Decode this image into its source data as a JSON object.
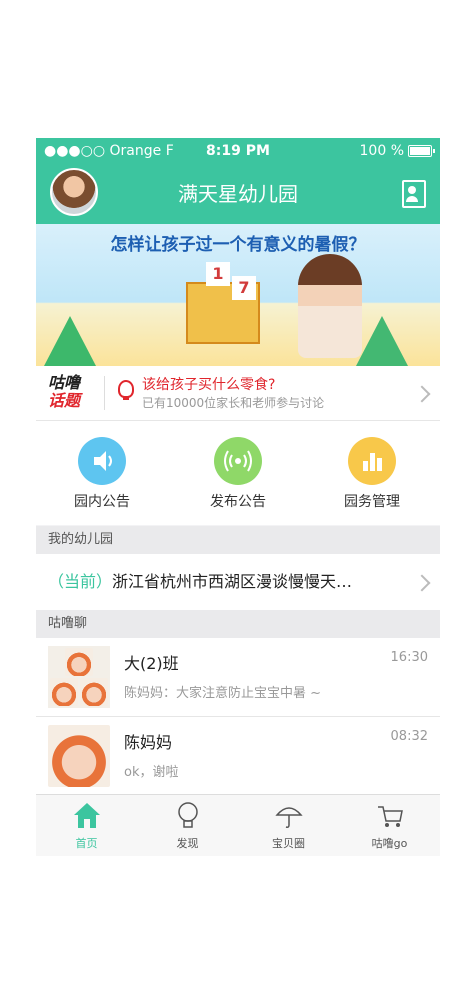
{
  "status_bar": {
    "carrier": "●●●○○ Orange F",
    "time": "8:19 PM",
    "battery": "100 %"
  },
  "nav": {
    "title": "满天星幼儿园"
  },
  "banner": {
    "headline": "怎样让孩子过一个有意义的暑假？",
    "block_1": "1",
    "block_2": "7"
  },
  "topic": {
    "tag_line1": "咕噜",
    "tag_line2": "话题",
    "question": "该给孩子买什么零食?",
    "participants": "已有10000位家长和老师参与讨论"
  },
  "actions": [
    {
      "label": "园内公告",
      "icon": "speaker-icon",
      "color": "#5ec5f0"
    },
    {
      "label": "发布公告",
      "icon": "broadcast-icon",
      "color": "#8fd868"
    },
    {
      "label": "园务管理",
      "icon": "bar-chart-icon",
      "color": "#f8c84a"
    }
  ],
  "sections": {
    "my_kindergarten": "我的幼儿园",
    "chat": "咕噜聊"
  },
  "kindergarten": {
    "tag": "（当前）",
    "address": "浙江省杭州市西湖区漫谈慢慢天…"
  },
  "chats": [
    {
      "name": "大(2)班",
      "time": "16:30",
      "message": "陈妈妈：大家注意防止宝宝中暑 ~"
    },
    {
      "name": "陈妈妈",
      "time": "08:32",
      "message": "ok，谢啦"
    }
  ],
  "tabs": [
    {
      "label": "首页",
      "icon": "home-icon"
    },
    {
      "label": "发现",
      "icon": "bulb-icon"
    },
    {
      "label": "宝贝圈",
      "icon": "umbrella-icon"
    },
    {
      "label": "咕噜go",
      "icon": "cart-icon"
    }
  ],
  "colors": {
    "primary": "#3cc59f",
    "accent_red": "#e0262d"
  }
}
